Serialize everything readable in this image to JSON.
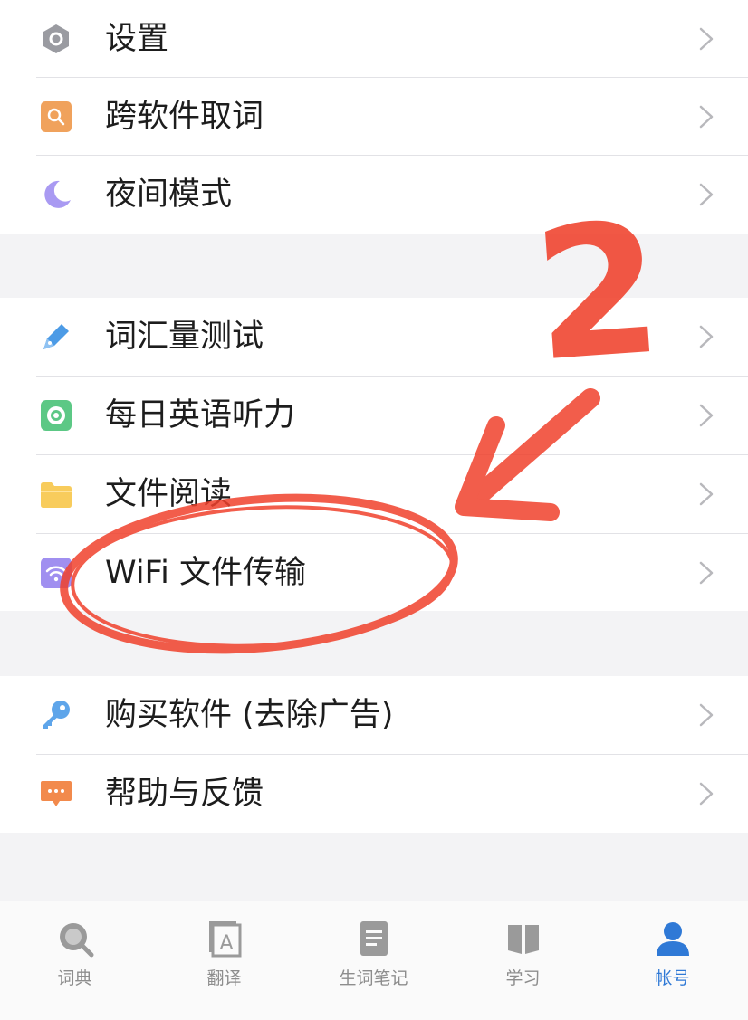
{
  "menu": {
    "group1": [
      {
        "label": "设置",
        "icon": "gear-icon",
        "color": "#9a9ba1"
      },
      {
        "label": "跨软件取词",
        "icon": "search-icon",
        "color": "#f0a25c"
      },
      {
        "label": "夜间模式",
        "icon": "moon-icon",
        "color": "#a99af2"
      }
    ],
    "group2": [
      {
        "label": "词汇量测试",
        "icon": "pen-icon",
        "color": "#4c9be6"
      },
      {
        "label": "每日英语听力",
        "icon": "radio-icon",
        "color": "#5cc885"
      },
      {
        "label": "文件阅读",
        "icon": "folder-icon",
        "color": "#f8cc5c"
      },
      {
        "label": "WiFi 文件传输",
        "icon": "wifi-icon",
        "color": "#a08ff0"
      }
    ],
    "group3": [
      {
        "label": "购买软件 (去除广告)",
        "icon": "key-icon",
        "color": "#5ea5ea"
      },
      {
        "label": "帮助与反馈",
        "icon": "feedback-icon",
        "color": "#f28a4c"
      }
    ]
  },
  "tabbar": {
    "tabs": [
      {
        "label": "词典",
        "icon": "dictionary-search-icon"
      },
      {
        "label": "翻译",
        "icon": "translate-icon"
      },
      {
        "label": "生词笔记",
        "icon": "notebook-icon"
      },
      {
        "label": "学习",
        "icon": "book-icon"
      },
      {
        "label": "帐号",
        "icon": "account-icon"
      }
    ],
    "active_tab": "帐号",
    "active_color": "#2f79d6",
    "inactive_color": "#8d8d8d"
  },
  "annotation": {
    "step_number": "2",
    "mark_color": "#f0412c"
  }
}
